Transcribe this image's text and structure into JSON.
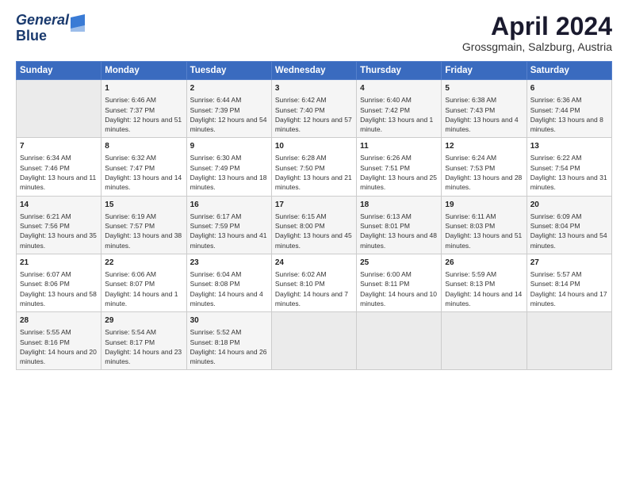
{
  "header": {
    "logo_line1": "General",
    "logo_line2": "Blue",
    "title": "April 2024",
    "subtitle": "Grossgmain, Salzburg, Austria"
  },
  "columns": [
    "Sunday",
    "Monday",
    "Tuesday",
    "Wednesday",
    "Thursday",
    "Friday",
    "Saturday"
  ],
  "weeks": [
    [
      {
        "day": "",
        "sunrise": "",
        "sunset": "",
        "daylight": ""
      },
      {
        "day": "1",
        "sunrise": "Sunrise: 6:46 AM",
        "sunset": "Sunset: 7:37 PM",
        "daylight": "Daylight: 12 hours and 51 minutes."
      },
      {
        "day": "2",
        "sunrise": "Sunrise: 6:44 AM",
        "sunset": "Sunset: 7:39 PM",
        "daylight": "Daylight: 12 hours and 54 minutes."
      },
      {
        "day": "3",
        "sunrise": "Sunrise: 6:42 AM",
        "sunset": "Sunset: 7:40 PM",
        "daylight": "Daylight: 12 hours and 57 minutes."
      },
      {
        "day": "4",
        "sunrise": "Sunrise: 6:40 AM",
        "sunset": "Sunset: 7:42 PM",
        "daylight": "Daylight: 13 hours and 1 minute."
      },
      {
        "day": "5",
        "sunrise": "Sunrise: 6:38 AM",
        "sunset": "Sunset: 7:43 PM",
        "daylight": "Daylight: 13 hours and 4 minutes."
      },
      {
        "day": "6",
        "sunrise": "Sunrise: 6:36 AM",
        "sunset": "Sunset: 7:44 PM",
        "daylight": "Daylight: 13 hours and 8 minutes."
      }
    ],
    [
      {
        "day": "7",
        "sunrise": "Sunrise: 6:34 AM",
        "sunset": "Sunset: 7:46 PM",
        "daylight": "Daylight: 13 hours and 11 minutes."
      },
      {
        "day": "8",
        "sunrise": "Sunrise: 6:32 AM",
        "sunset": "Sunset: 7:47 PM",
        "daylight": "Daylight: 13 hours and 14 minutes."
      },
      {
        "day": "9",
        "sunrise": "Sunrise: 6:30 AM",
        "sunset": "Sunset: 7:49 PM",
        "daylight": "Daylight: 13 hours and 18 minutes."
      },
      {
        "day": "10",
        "sunrise": "Sunrise: 6:28 AM",
        "sunset": "Sunset: 7:50 PM",
        "daylight": "Daylight: 13 hours and 21 minutes."
      },
      {
        "day": "11",
        "sunrise": "Sunrise: 6:26 AM",
        "sunset": "Sunset: 7:51 PM",
        "daylight": "Daylight: 13 hours and 25 minutes."
      },
      {
        "day": "12",
        "sunrise": "Sunrise: 6:24 AM",
        "sunset": "Sunset: 7:53 PM",
        "daylight": "Daylight: 13 hours and 28 minutes."
      },
      {
        "day": "13",
        "sunrise": "Sunrise: 6:22 AM",
        "sunset": "Sunset: 7:54 PM",
        "daylight": "Daylight: 13 hours and 31 minutes."
      }
    ],
    [
      {
        "day": "14",
        "sunrise": "Sunrise: 6:21 AM",
        "sunset": "Sunset: 7:56 PM",
        "daylight": "Daylight: 13 hours and 35 minutes."
      },
      {
        "day": "15",
        "sunrise": "Sunrise: 6:19 AM",
        "sunset": "Sunset: 7:57 PM",
        "daylight": "Daylight: 13 hours and 38 minutes."
      },
      {
        "day": "16",
        "sunrise": "Sunrise: 6:17 AM",
        "sunset": "Sunset: 7:59 PM",
        "daylight": "Daylight: 13 hours and 41 minutes."
      },
      {
        "day": "17",
        "sunrise": "Sunrise: 6:15 AM",
        "sunset": "Sunset: 8:00 PM",
        "daylight": "Daylight: 13 hours and 45 minutes."
      },
      {
        "day": "18",
        "sunrise": "Sunrise: 6:13 AM",
        "sunset": "Sunset: 8:01 PM",
        "daylight": "Daylight: 13 hours and 48 minutes."
      },
      {
        "day": "19",
        "sunrise": "Sunrise: 6:11 AM",
        "sunset": "Sunset: 8:03 PM",
        "daylight": "Daylight: 13 hours and 51 minutes."
      },
      {
        "day": "20",
        "sunrise": "Sunrise: 6:09 AM",
        "sunset": "Sunset: 8:04 PM",
        "daylight": "Daylight: 13 hours and 54 minutes."
      }
    ],
    [
      {
        "day": "21",
        "sunrise": "Sunrise: 6:07 AM",
        "sunset": "Sunset: 8:06 PM",
        "daylight": "Daylight: 13 hours and 58 minutes."
      },
      {
        "day": "22",
        "sunrise": "Sunrise: 6:06 AM",
        "sunset": "Sunset: 8:07 PM",
        "daylight": "Daylight: 14 hours and 1 minute."
      },
      {
        "day": "23",
        "sunrise": "Sunrise: 6:04 AM",
        "sunset": "Sunset: 8:08 PM",
        "daylight": "Daylight: 14 hours and 4 minutes."
      },
      {
        "day": "24",
        "sunrise": "Sunrise: 6:02 AM",
        "sunset": "Sunset: 8:10 PM",
        "daylight": "Daylight: 14 hours and 7 minutes."
      },
      {
        "day": "25",
        "sunrise": "Sunrise: 6:00 AM",
        "sunset": "Sunset: 8:11 PM",
        "daylight": "Daylight: 14 hours and 10 minutes."
      },
      {
        "day": "26",
        "sunrise": "Sunrise: 5:59 AM",
        "sunset": "Sunset: 8:13 PM",
        "daylight": "Daylight: 14 hours and 14 minutes."
      },
      {
        "day": "27",
        "sunrise": "Sunrise: 5:57 AM",
        "sunset": "Sunset: 8:14 PM",
        "daylight": "Daylight: 14 hours and 17 minutes."
      }
    ],
    [
      {
        "day": "28",
        "sunrise": "Sunrise: 5:55 AM",
        "sunset": "Sunset: 8:16 PM",
        "daylight": "Daylight: 14 hours and 20 minutes."
      },
      {
        "day": "29",
        "sunrise": "Sunrise: 5:54 AM",
        "sunset": "Sunset: 8:17 PM",
        "daylight": "Daylight: 14 hours and 23 minutes."
      },
      {
        "day": "30",
        "sunrise": "Sunrise: 5:52 AM",
        "sunset": "Sunset: 8:18 PM",
        "daylight": "Daylight: 14 hours and 26 minutes."
      },
      {
        "day": "",
        "sunrise": "",
        "sunset": "",
        "daylight": ""
      },
      {
        "day": "",
        "sunrise": "",
        "sunset": "",
        "daylight": ""
      },
      {
        "day": "",
        "sunrise": "",
        "sunset": "",
        "daylight": ""
      },
      {
        "day": "",
        "sunrise": "",
        "sunset": "",
        "daylight": ""
      }
    ]
  ]
}
